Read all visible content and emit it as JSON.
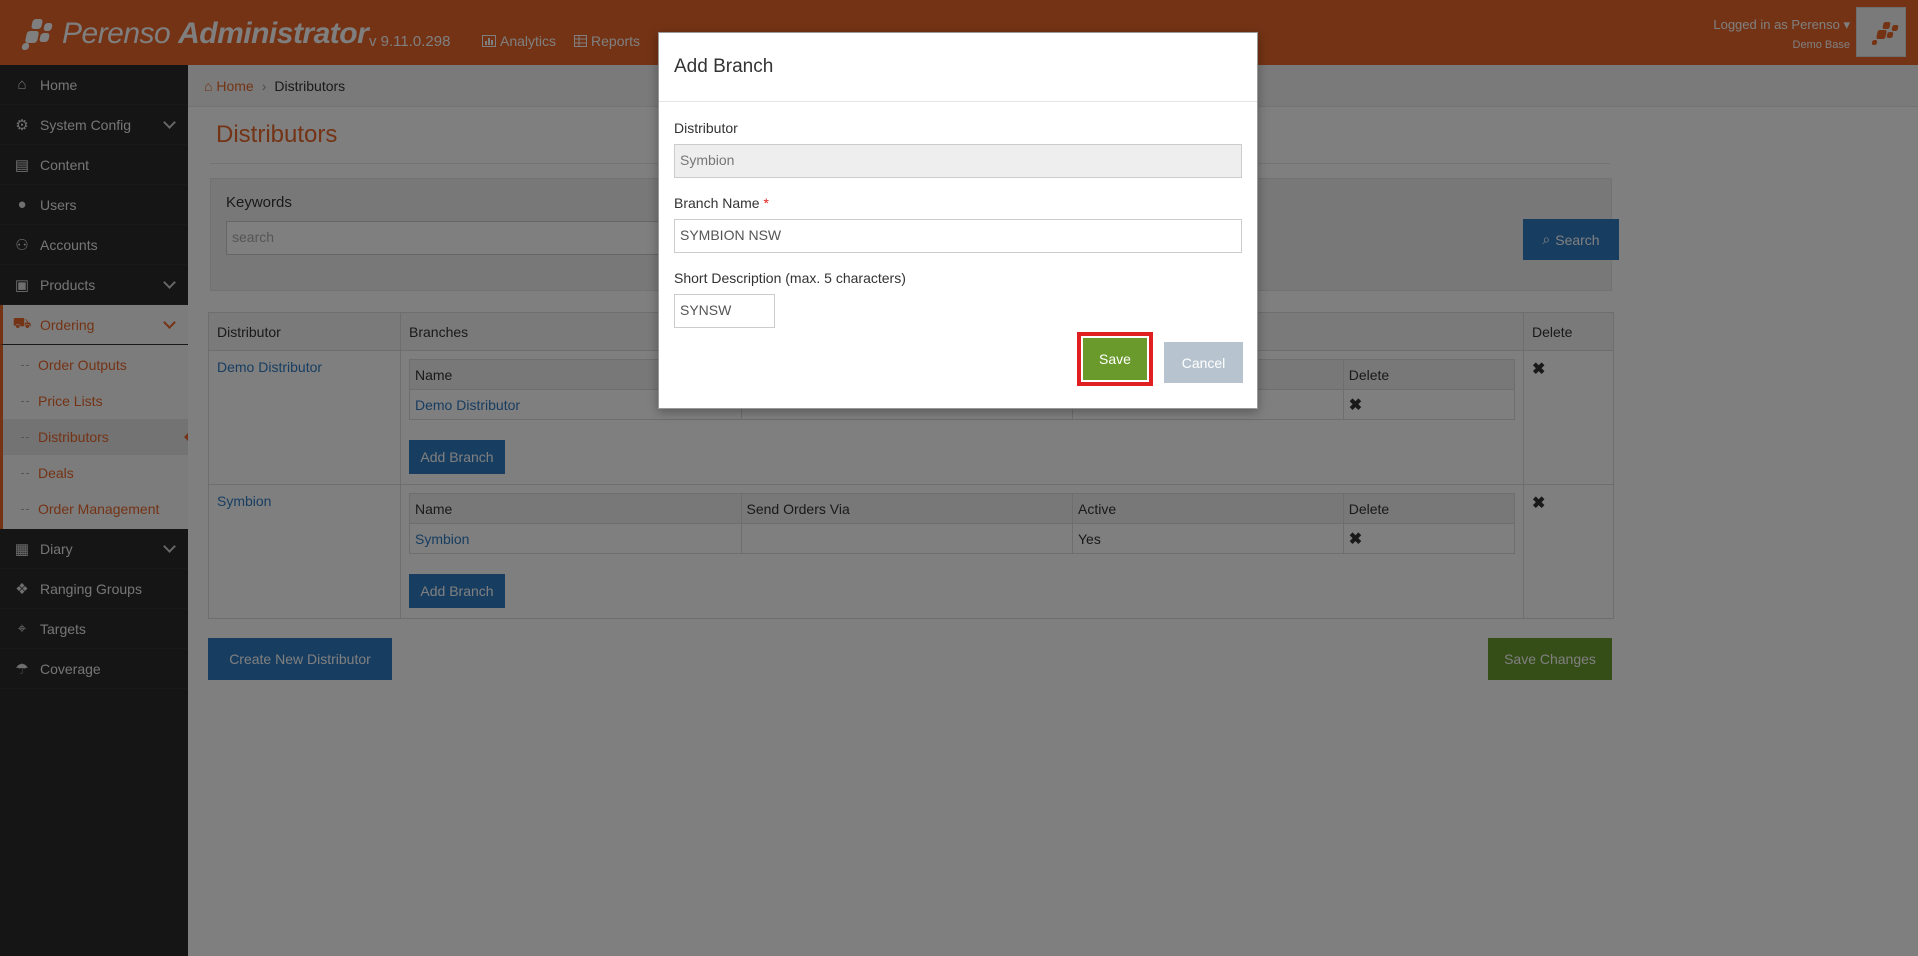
{
  "header": {
    "brand_light": "Perenso",
    "brand_bold": "Administrator",
    "version": "v 9.11.0.298",
    "nav": [
      {
        "label": "Analytics",
        "icon": "chart-icon"
      },
      {
        "label": "Reports",
        "icon": "table-icon"
      }
    ],
    "user_line": "Logged in as Perenso",
    "user_sub": "Demo Base"
  },
  "sidebar": {
    "items": [
      {
        "label": "Home",
        "icon": "home-icon"
      },
      {
        "label": "System Config",
        "icon": "gear-icon"
      },
      {
        "label": "Content",
        "icon": "file-icon"
      },
      {
        "label": "Users",
        "icon": "user-icon"
      },
      {
        "label": "Accounts",
        "icon": "users-icon"
      },
      {
        "label": "Products",
        "icon": "gift-icon"
      },
      {
        "label": "Ordering",
        "icon": "cart-icon"
      },
      {
        "label": "Diary",
        "icon": "calendar-icon"
      },
      {
        "label": "Ranging Groups",
        "icon": "cubes-icon"
      },
      {
        "label": "Targets",
        "icon": "crosshairs-icon"
      },
      {
        "label": "Coverage",
        "icon": "umbrella-icon"
      }
    ],
    "ordering_sub": [
      {
        "label": "Order Outputs"
      },
      {
        "label": "Price Lists"
      },
      {
        "label": "Distributors"
      },
      {
        "label": "Deals"
      },
      {
        "label": "Order Management"
      }
    ]
  },
  "breadcrumb": {
    "home": "Home",
    "current": "Distributors"
  },
  "page": {
    "title": "Distributors"
  },
  "search": {
    "label": "Keywords",
    "placeholder": "search",
    "button": "Search"
  },
  "table": {
    "headers": [
      "Distributor",
      "Branches",
      "Delete"
    ],
    "inner_headers": [
      "Name",
      "Send Orders Via",
      "Active",
      "Delete"
    ],
    "distributors": [
      {
        "name": "Demo Distributor",
        "branches": [
          {
            "name": "Demo Distributor",
            "via": "",
            "active": ""
          }
        ]
      },
      {
        "name": "Symbion",
        "branches": [
          {
            "name": "Symbion",
            "via": "",
            "active": "Yes"
          }
        ]
      }
    ],
    "add_branch": "Add Branch",
    "delete_glyph": "✖"
  },
  "actions": {
    "create": "Create New Distributor",
    "save_changes": "Save Changes"
  },
  "modal": {
    "title": "Add Branch",
    "distributor_label": "Distributor",
    "distributor_value": "Symbion",
    "branch_name_label": "Branch Name",
    "required_mark": "*",
    "branch_name_value": "SYMBION NSW",
    "short_desc_label": "Short Description (max. 5 characters)",
    "short_desc_value": "SYNSW",
    "save": "Save",
    "cancel": "Cancel"
  },
  "colors": {
    "brand": "#e8662a",
    "primary": "#2f7bc2",
    "success": "#6a9a2c",
    "highlight": "#e02020"
  }
}
